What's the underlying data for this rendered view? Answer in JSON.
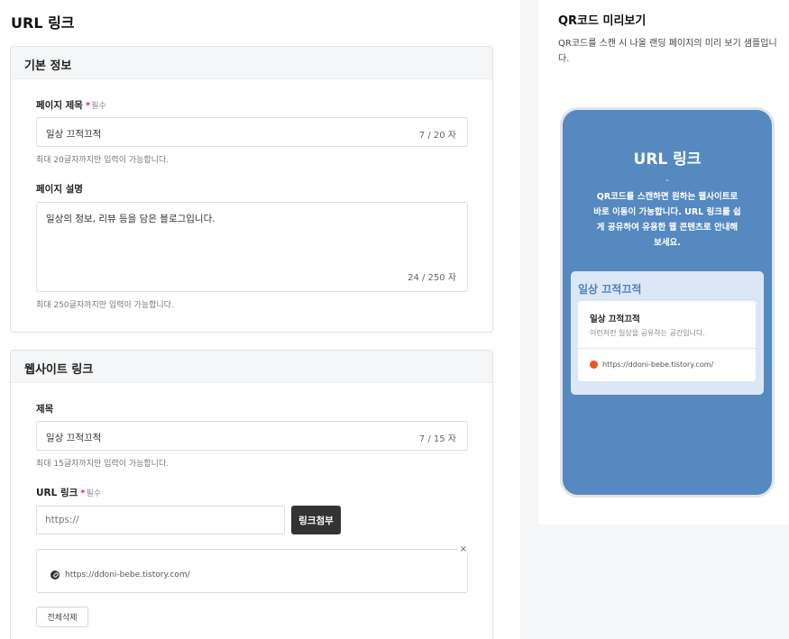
{
  "editor": {
    "title": "URL 링크",
    "basic_info": {
      "header": "기본 정보",
      "page_title_label": "페이지 제목",
      "required_star": "*",
      "required_text": "필수",
      "page_title_value": "일상 끄적끄적",
      "page_title_count": "7 / 20 자",
      "page_title_hint": "최대 20글자까지만 입력이 가능합니다.",
      "page_desc_label": "페이지 설명",
      "page_desc_value": "일상의 정보, 리뷰 등을 담은 블로그입니다.",
      "page_desc_count": "24 / 250 자",
      "page_desc_hint": "최대 250글자까지만 입력이 가능합니다."
    },
    "website_link": {
      "header": "웹사이트 링크",
      "title_label": "제목",
      "title_value": "일상 끄적끄적",
      "title_count": "7 / 15 자",
      "title_hint": "최대 15글자까지만 입력이 가능합니다.",
      "url_label": "URL 링크",
      "required_star": "*",
      "required_text": "필수",
      "url_placeholder": "https://",
      "attach_button": "링크첨부",
      "close_symbol": "×",
      "attached_url": "https://ddoni-bebe.tistory.com/",
      "delete_all_button": "전체삭제"
    }
  },
  "preview": {
    "title": "QR코드 미리보기",
    "description": "QR코드를 스캔 시 나올 랜딩 페이지의 미리 보기 샘플입니다.",
    "phone": {
      "heading": "URL 링크",
      "dash": "-",
      "description": "QR코드를 스캔하면 원하는 웹사이트로 바로 이동이 가능합니다. URL 링크를 쉽게 공유하여 유용한 웹 콘텐츠로 안내해 보세요.",
      "card_title": "일상 끄적끄적",
      "link_title": "일상 끄적끄적",
      "link_desc": "이런저런 일상을 공유하는 공간입니다.",
      "link_url": "https://ddoni-bebe.tistory.com/"
    }
  },
  "colors": {
    "phone_bg": "#5589c0",
    "card_bg": "#dce7f5",
    "accent": "#4f7fb9",
    "required": "#e0323c",
    "attach_button_bg": "#333333",
    "tistory_icon": "#eb531f"
  }
}
